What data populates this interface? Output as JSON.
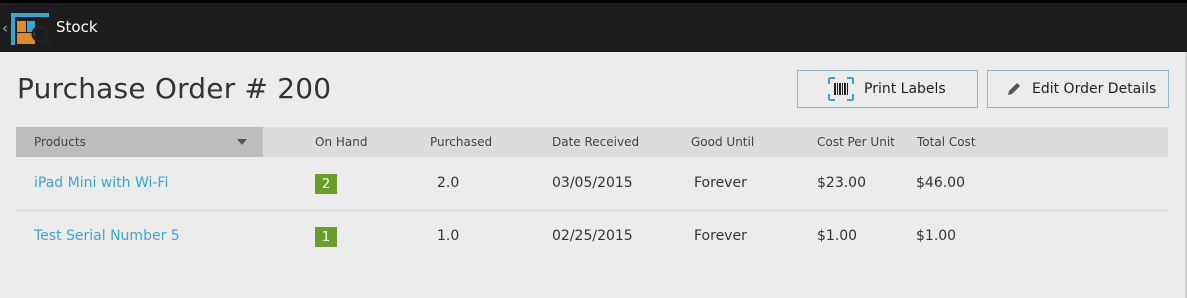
{
  "app": {
    "title": "Stock"
  },
  "page": {
    "title": "Purchase Order # 200"
  },
  "buttons": {
    "print_labels": "Print Labels",
    "edit_order_details": "Edit Order Details"
  },
  "table": {
    "headers": {
      "products": "Products",
      "on_hand": "On Hand",
      "purchased": "Purchased",
      "date_received": "Date Received",
      "good_until": "Good Until",
      "cost_per_unit": "Cost Per Unit",
      "total_cost": "Total Cost"
    },
    "rows": [
      {
        "product": "iPad Mini with Wi-Fi",
        "on_hand": "2",
        "purchased": "2.0",
        "date_received": "03/05/2015",
        "good_until": "Forever",
        "cost_per_unit": "$23.00",
        "total_cost": "$46.00"
      },
      {
        "product": "Test Serial Number 5",
        "on_hand": "1",
        "purchased": "1.0",
        "date_received": "02/25/2015",
        "good_until": "Forever",
        "cost_per_unit": "$1.00",
        "total_cost": "$1.00"
      }
    ]
  },
  "colors": {
    "topbar": "#1c1c1c",
    "link": "#3aa6d6",
    "badge": "#6a9e2a",
    "button_border": "#8fb8c8"
  },
  "icons": [
    "back-chevron-icon",
    "stock-app-icon",
    "barcode-icon",
    "pencil-icon",
    "dropdown-arrow-icon"
  ]
}
